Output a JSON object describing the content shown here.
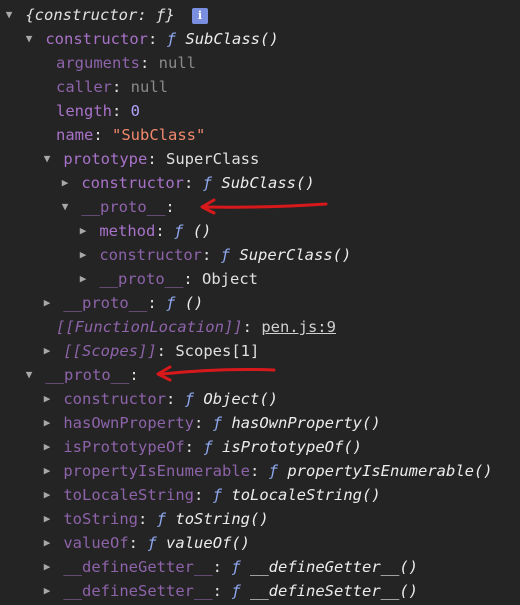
{
  "header": {
    "summary": "{constructor: ƒ}",
    "info_badge": "i"
  },
  "rows": [
    {
      "key": "constructor",
      "value_kind": "fn",
      "value": "SubClass()"
    },
    {
      "key": "arguments",
      "value": "null"
    },
    {
      "key": "caller",
      "value": "null"
    },
    {
      "key": "length",
      "value": "0"
    },
    {
      "key": "name",
      "value": "\"SubClass\""
    },
    {
      "key": "prototype",
      "value": "SuperClass"
    },
    {
      "key": "constructor",
      "value": "SubClass()"
    },
    {
      "key": "__proto__",
      "value": ""
    },
    {
      "key": "method",
      "value": "()"
    },
    {
      "key": "constructor",
      "value": "SuperClass()"
    },
    {
      "key": "__proto__",
      "value": "Object"
    },
    {
      "key": "__proto__",
      "value": "()"
    },
    {
      "key": "[[FunctionLocation]]",
      "value": "pen.js:9"
    },
    {
      "key": "[[Scopes]]",
      "value": "Scopes[1]"
    },
    {
      "key": "__proto__",
      "value": ""
    },
    {
      "key": "constructor",
      "value": "Object()"
    },
    {
      "key": "hasOwnProperty",
      "value": "hasOwnProperty()"
    },
    {
      "key": "isPrototypeOf",
      "value": "isPrototypeOf()"
    },
    {
      "key": "propertyIsEnumerable",
      "value": "propertyIsEnumerable()"
    },
    {
      "key": "toLocaleString",
      "value": "toLocaleString()"
    },
    {
      "key": "toString",
      "value": "toString()"
    },
    {
      "key": "valueOf",
      "value": "valueOf()"
    },
    {
      "key": "__defineGetter__",
      "value": "__defineGetter__()"
    },
    {
      "key": "__defineSetter__",
      "value": "__defineSetter__()"
    }
  ],
  "glyphs": {
    "f": "ƒ",
    "expanded": "▼",
    "collapsed": "▶",
    "sep": ":"
  },
  "colors": {
    "background": "#242424",
    "key": "#a872c9",
    "function": "#8fa8f0",
    "string": "#f2896d",
    "number": "#b3a3ff",
    "arrow": "#d8191c"
  },
  "icons": [
    "info-icon",
    "expand-triangle-icon",
    "collapse-triangle-icon",
    "red-arrow-annotation"
  ]
}
